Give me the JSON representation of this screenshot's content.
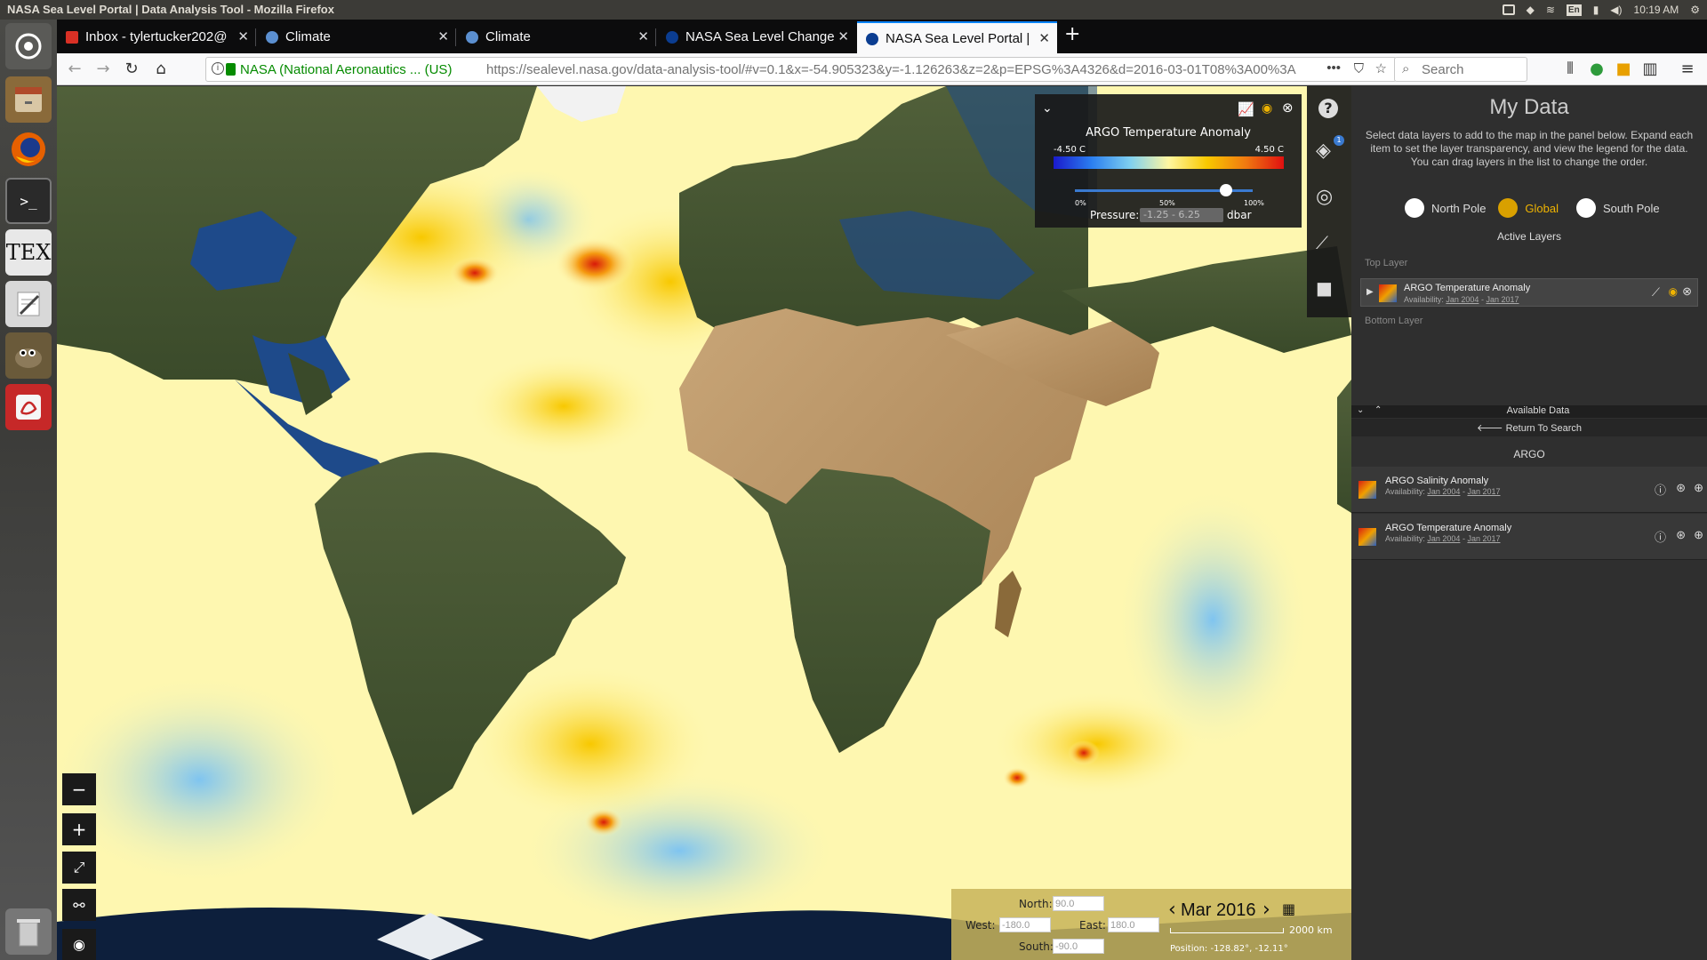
{
  "window_title": "NASA Sea Level Portal | Data Analysis Tool - Mozilla Firefox",
  "system": {
    "lang": "En",
    "time": "10:19 AM"
  },
  "tabs": [
    {
      "label": "Inbox - tylertucker202@"
    },
    {
      "label": "Climate"
    },
    {
      "label": "Climate"
    },
    {
      "label": "NASA Sea Level Change"
    },
    {
      "label": "NASA Sea Level Portal | "
    }
  ],
  "address": {
    "identity": "NASA (National Aeronautics ... (US)",
    "url": "https://sealevel.nasa.gov/data-analysis-tool/#v=0.1&x=-54.905323&y=-1.126263&z=2&p=EPSG%3A4326&d=2016-03-01T08%3A00%3A"
  },
  "search_placeholder": "Search",
  "legend": {
    "title": "ARGO Temperature Anomaly",
    "min": "-4.50 C",
    "max": "4.50 C",
    "opacity_ticks": [
      "0%",
      "50%",
      "100%"
    ],
    "opacity_value": 0.85,
    "pressure_label": "Pressure:",
    "pressure_value": "-1.25 -   6.25",
    "pressure_unit": "dbar"
  },
  "layers_badge": "1",
  "panel": {
    "title": "My Data",
    "description": "Select data layers to add to the map in the panel below. Expand each item to set the layer transparency, and view the legend for the data. You can drag layers in the list to change the order.",
    "projections": [
      "North Pole",
      "Global",
      "South Pole"
    ],
    "active_layers_label": "Active Layers",
    "top_layer_label": "Top Layer",
    "bottom_layer_label": "Bottom Layer",
    "active_layer": {
      "name": "ARGO Temperature Anomaly",
      "availability_label": "Availability:",
      "start": "Jan 2004",
      "sep": "-",
      "end": "Jan 2017"
    },
    "available_data_label": "Available Data",
    "return_label": "Return To Search",
    "group_label": "ARGO",
    "datasets": [
      {
        "name": "ARGO Salinity Anomaly",
        "availability_label": "Availability:",
        "start": "Jan 2004",
        "sep": "-",
        "end": "Jan 2017"
      },
      {
        "name": "ARGO Temperature Anomaly",
        "availability_label": "Availability:",
        "start": "Jan 2004",
        "sep": "-",
        "end": "Jan 2017"
      }
    ]
  },
  "bbox": {
    "north_label": "North:",
    "north": "90.0",
    "west_label": "West:",
    "west": "-180.0",
    "east_label": "East:",
    "east": "180.0",
    "south_label": "South:",
    "south": "-90.0"
  },
  "date": "Mar 2016",
  "scale": "2000 km",
  "position_label": "Position:",
  "position": "-128.82°, -12.11°",
  "colors": {
    "accent": "#f0b400",
    "panel": "#2f2f2f",
    "ocean": "#fef9b0"
  }
}
